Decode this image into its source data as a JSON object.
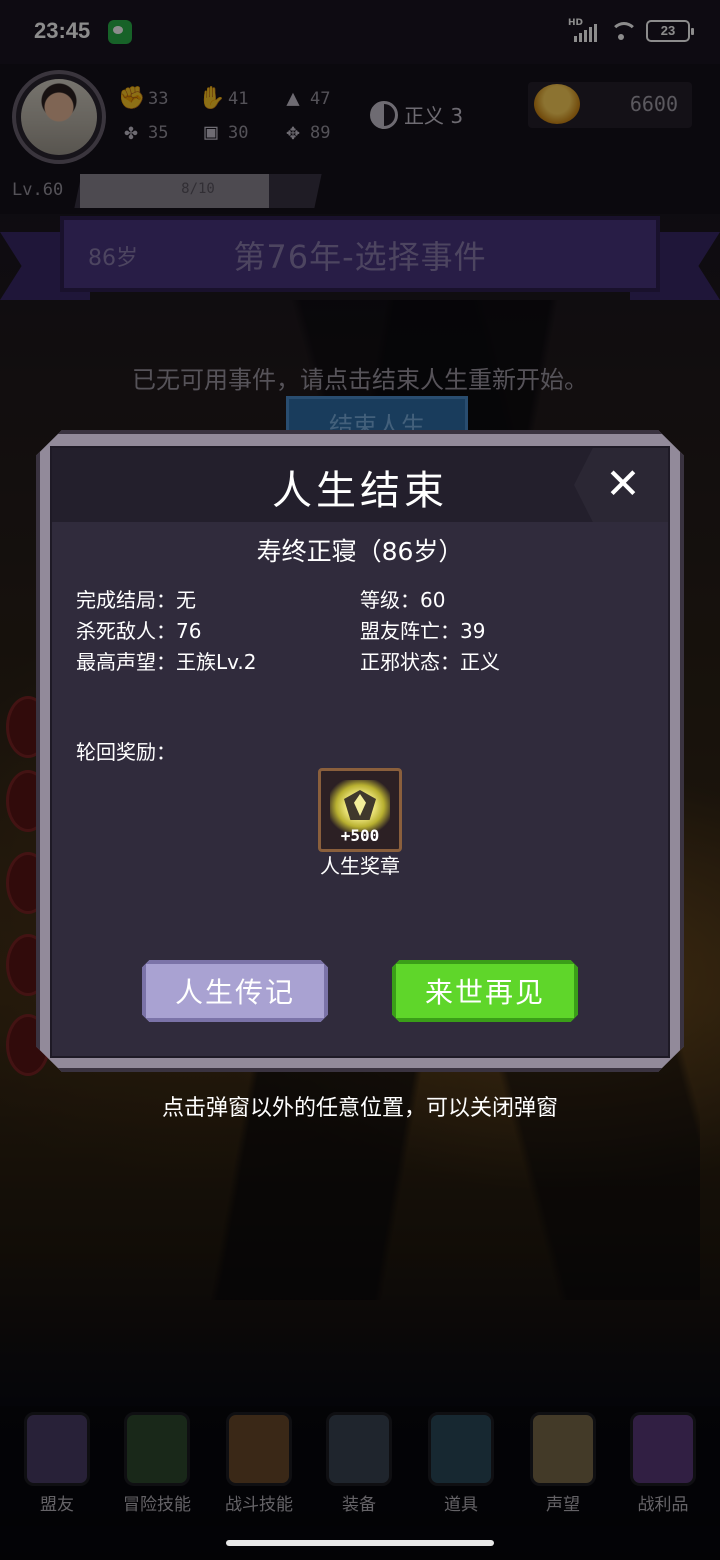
{
  "status_bar": {
    "time": "23:45",
    "network": "HD",
    "battery": "23"
  },
  "player": {
    "stats": {
      "power": "33",
      "charm": "41",
      "magic": "47",
      "luck": "35",
      "body": "30",
      "spirit": "89"
    },
    "alignment": "正义 3",
    "gold": "6600",
    "level": "Lv.60",
    "xp": "8/10",
    "xp_fraction": 0.8
  },
  "banner": {
    "age": "86岁",
    "title": "第76年-选择事件"
  },
  "main": {
    "no_event_text": "已无可用事件，请点击结束人生重新开始。",
    "end_life_button": "结束人生"
  },
  "popup": {
    "title": "人生结束",
    "close_icon": "close-icon",
    "death_cause": "寿终正寝（86岁）",
    "summary": {
      "ending_label": "完成结局",
      "ending_value": "无",
      "level_label": "等级",
      "level_value": "60",
      "kills_label": "杀死敌人",
      "kills_value": "76",
      "ally_deaths_label": "盟友阵亡",
      "ally_deaths_value": "39",
      "fame_label": "最高声望",
      "fame_value": "王族Lv.2",
      "alignment_label": "正邪状态",
      "alignment_value": "正义"
    },
    "reward_label": "轮回奖励：",
    "reward": {
      "amount": "+500",
      "name": "人生奖章",
      "icon": "medal-icon"
    },
    "biography_button": "人生传记",
    "next_life_button": "来世再见"
  },
  "hint": "点击弹窗以外的任意位置，可以关闭弹窗",
  "nav": {
    "items": [
      {
        "label": "盟友",
        "icon": "allies-icon"
      },
      {
        "label": "冒险技能",
        "icon": "adventure-book-icon"
      },
      {
        "label": "战斗技能",
        "icon": "backpack-icon"
      },
      {
        "label": "装备",
        "icon": "crossed-swords-icon"
      },
      {
        "label": "道具",
        "icon": "satchel-icon"
      },
      {
        "label": "声望",
        "icon": "scroll-icon"
      },
      {
        "label": "战利品",
        "icon": "treasure-chest-icon"
      }
    ]
  },
  "colors": {
    "banner": "#4a3580",
    "popup_body": "#302b3c",
    "biography_button": "#a9a2d2",
    "next_life_button": "#5fd62a",
    "end_life_button": "#2e6ea8"
  }
}
